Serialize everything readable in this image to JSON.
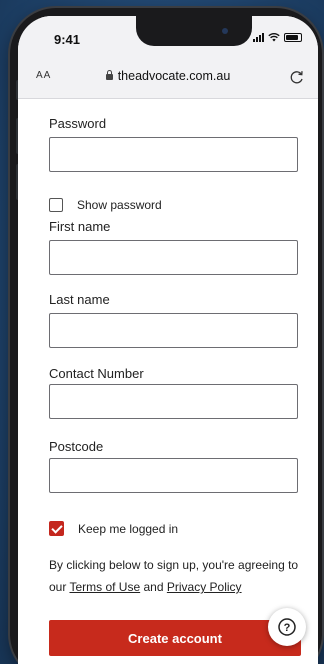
{
  "status_bar": {
    "time": "9:41"
  },
  "browser": {
    "text_size_label": "AA",
    "url": "theadvocate.com.au"
  },
  "form": {
    "password_label": "Password",
    "show_password_label": "Show password",
    "first_name_label": "First name",
    "last_name_label": "Last name",
    "contact_number_label": "Contact Number",
    "postcode_label": "Postcode",
    "keep_logged_in_label": "Keep me logged in",
    "keep_logged_in_checked": true,
    "show_password_checked": false,
    "legal_prefix": "By clicking below to sign up, you're agreeing to our",
    "terms_link": "Terms of Use",
    "legal_and": "and",
    "privacy_link": "Privacy Policy",
    "submit_label": "Create account"
  },
  "help": {
    "icon": "question-icon",
    "glyph": "?"
  },
  "colors": {
    "accent": "#c72a1c",
    "background": "#20456e"
  }
}
